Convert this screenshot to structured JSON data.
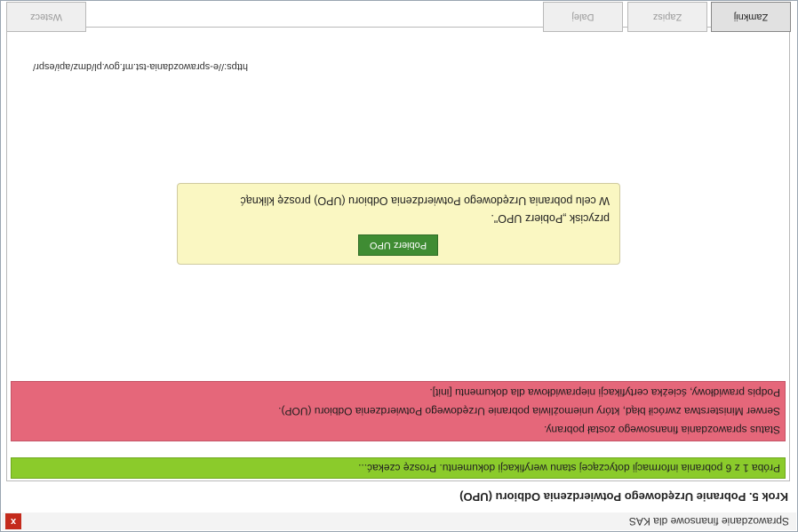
{
  "window": {
    "title": "Sprawozdanie finansowe dla KAS",
    "close_glyph": "x"
  },
  "step_title": "Krok 5. Pobranie Urzędowego Potwierdzenia Odbioru (UPO)",
  "progress_message": "Próba 1 z 6 pobrania informacji dotyczącej stanu weryfikacji dokumentu. Proszę czekać...",
  "error_lines": [
    "Status sprawozdania finansowego został pobrany.",
    "Serwer Ministerstwa zwrócił błąd, który uniemożliwia pobranie Urzędowego Potwierdzenia Odbioru (UOP).",
    "Podpis prawidłowy, ścieżka certyfikacji nieprawidłowa dla dokumentu [init]."
  ],
  "info_box": {
    "line1": "W celu pobrania Urzędowego Potwierdzenia Odbioru (UPO) proszę kliknąć",
    "line2": "przycisk „Pobierz UPO\".",
    "button_label": "Pobierz UPO"
  },
  "url": "https://e-sprawozdania-tst.mf.gov.pl/dmz/api/espr/",
  "footer": {
    "back_label": "Wstecz",
    "next_label": "Dalej",
    "save_label": "Zapisz",
    "close_label": "Zamknij"
  },
  "colors": {
    "progress_bar": "#8bcb2b",
    "error_bar": "#e5677a",
    "info_box": "#faf7c2",
    "download_button": "#3f8c33",
    "close_button": "#c42b1c"
  }
}
